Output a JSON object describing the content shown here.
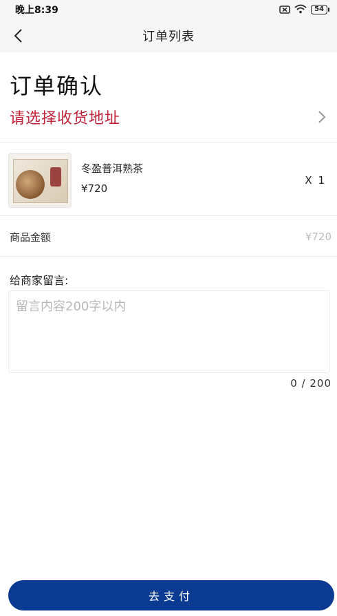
{
  "status_bar": {
    "time": "晚上8:39",
    "battery": "54"
  },
  "nav": {
    "title": "订单列表"
  },
  "page": {
    "heading": "订单确认",
    "address_prompt": "请选择收货地址"
  },
  "product": {
    "name": "冬盈普洱熟茶",
    "price": "¥720",
    "quantity": "X 1"
  },
  "summary": {
    "amount_label": "商品金额",
    "amount_value": "¥720"
  },
  "message": {
    "label": "给商家留言:",
    "placeholder": "留言内容200字以内",
    "value": "",
    "count": "0 / 200"
  },
  "footer": {
    "pay_label": "去支付"
  },
  "colors": {
    "accent_red": "#c0233a",
    "pay_button": "#0b3a93"
  }
}
